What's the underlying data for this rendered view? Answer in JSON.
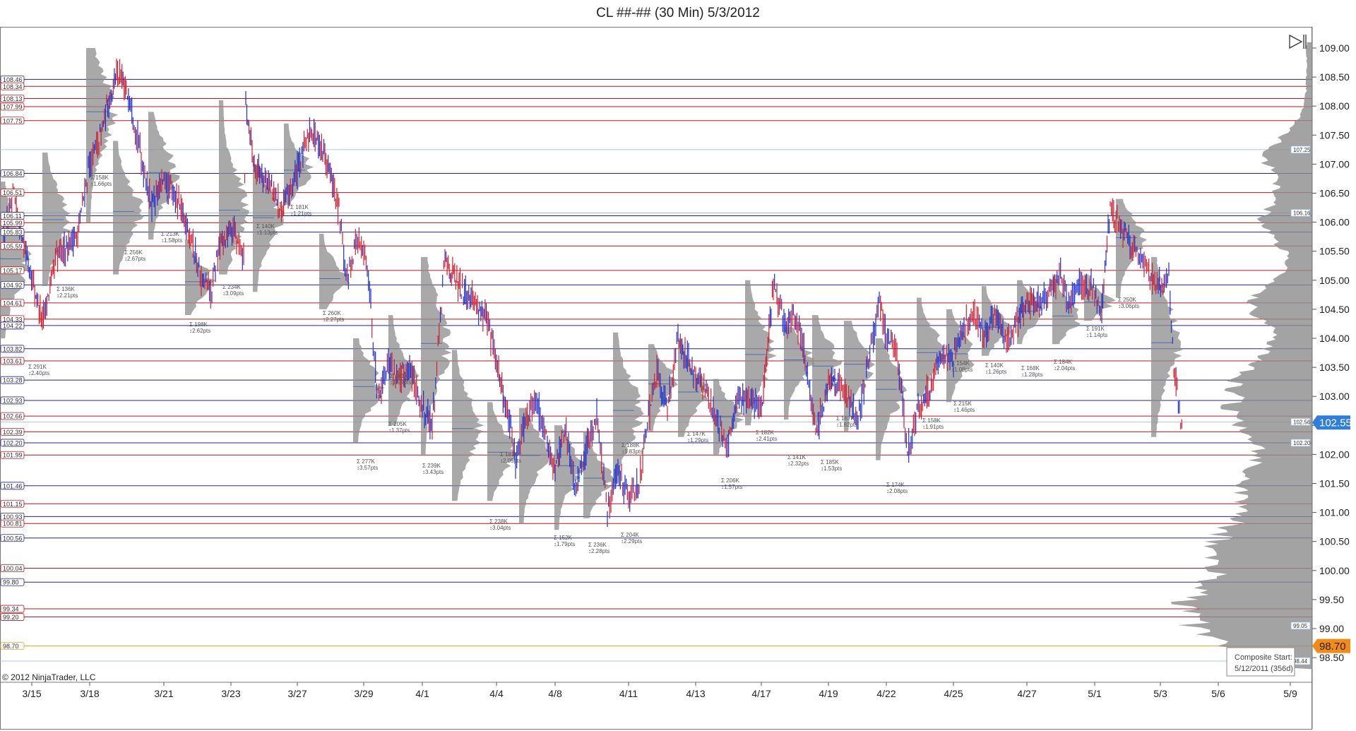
{
  "title": "CL ##-## (30 Min)  5/3/2012",
  "copyright": "© 2012 NinjaTrader, LLC",
  "last_price_label": "102.55",
  "alert_price_label": "98.70",
  "composite_box": {
    "line1": "Composite Start:",
    "line2": "5/12/2011 (356d)"
  },
  "colors": {
    "bull": "#1f2fd0",
    "bear": "#d01f2f",
    "blue_line": "#23238e",
    "red_line": "#b8141e",
    "gold_line": "#e3a21a",
    "profile": "#8c8c8c",
    "last_tag": "#2f7fd8",
    "alert_tag": "#f28c18"
  },
  "chart_data": {
    "type": "line",
    "title": "CL ##-## (30 Min)  5/3/2012",
    "ylim": [
      98.2,
      109.3
    ],
    "y_ticks": [
      "98.50",
      "99.00",
      "99.50",
      "100.00",
      "100.50",
      "101.00",
      "101.50",
      "102.00",
      "102.50",
      "103.00",
      "103.50",
      "104.00",
      "104.50",
      "105.00",
      "105.50",
      "106.00",
      "106.50",
      "107.00",
      "107.50",
      "108.00",
      "108.50",
      "109.00"
    ],
    "x_labels": [
      "3/15",
      "3/18",
      "3/21",
      "3/23",
      "3/27",
      "3/29",
      "4/1",
      "4/4",
      "4/8",
      "4/11",
      "4/13",
      "4/17",
      "4/19",
      "4/22",
      "4/25",
      "4/27",
      "5/1",
      "5/3",
      "5/6",
      "5/9"
    ],
    "series": [
      {
        "x": [
          "3/15",
          "3/18",
          "3/21",
          "3/23",
          "3/27",
          "3/29",
          "4/1",
          "4/4",
          "4/8",
          "4/11",
          "4/13",
          "4/17",
          "4/19",
          "4/22",
          "4/25",
          "4/27",
          "5/1",
          "5/3"
        ],
        "values": [
          105.6,
          108.2,
          106.6,
          105.6,
          107.0,
          105.4,
          103.5,
          104.0,
          102.0,
          101.4,
          103.2,
          102.8,
          103.5,
          102.8,
          103.9,
          104.6,
          106.0,
          102.55
        ]
      }
    ],
    "horizontal_levels": [
      {
        "price": 108.46,
        "label": "108.46",
        "color": "blue"
      },
      {
        "price": 108.34,
        "label": "108.34",
        "color": "red"
      },
      {
        "price": 108.13,
        "label": "108.13",
        "color": "red"
      },
      {
        "price": 107.99,
        "label": "107.99",
        "color": "red"
      },
      {
        "price": 107.75,
        "label": "107.75",
        "color": "red"
      },
      {
        "price": 106.84,
        "label": "106.84",
        "color": "blue"
      },
      {
        "price": 106.51,
        "label": "106.51",
        "color": "red"
      },
      {
        "price": 106.11,
        "label": "106.11",
        "color": "blue"
      },
      {
        "price": 105.99,
        "label": "105.99",
        "color": "red"
      },
      {
        "price": 105.83,
        "label": "105.83",
        "color": "blue"
      },
      {
        "price": 105.59,
        "label": "105.59",
        "color": "red"
      },
      {
        "price": 105.17,
        "label": "105.17",
        "color": "red"
      },
      {
        "price": 104.92,
        "label": "104.92",
        "color": "blue"
      },
      {
        "price": 104.61,
        "label": "104.61",
        "color": "red"
      },
      {
        "price": 104.33,
        "label": "104.33",
        "color": "red"
      },
      {
        "price": 104.22,
        "label": "104.22",
        "color": "blue"
      },
      {
        "price": 103.82,
        "label": "103.82",
        "color": "blue"
      },
      {
        "price": 103.61,
        "label": "103.61",
        "color": "red"
      },
      {
        "price": 103.28,
        "label": "103.28",
        "color": "blue"
      },
      {
        "price": 102.93,
        "label": "102.93",
        "color": "blue"
      },
      {
        "price": 102.66,
        "label": "102.66",
        "color": "red"
      },
      {
        "price": 102.39,
        "label": "102.39",
        "color": "red"
      },
      {
        "price": 102.2,
        "label": "102.20",
        "color": "blue"
      },
      {
        "price": 101.99,
        "label": "101.99",
        "color": "red"
      },
      {
        "price": 101.46,
        "label": "101.46",
        "color": "blue"
      },
      {
        "price": 101.15,
        "label": "101.15",
        "color": "red"
      },
      {
        "price": 100.93,
        "label": "100.93",
        "color": "blue"
      },
      {
        "price": 100.81,
        "label": "100.81",
        "color": "red"
      },
      {
        "price": 100.56,
        "label": "100.56",
        "color": "blue"
      },
      {
        "price": 100.04,
        "label": "100.04",
        "color": "red"
      },
      {
        "price": 99.8,
        "label": "99.80",
        "color": "blue"
      },
      {
        "price": 99.34,
        "label": "99.34",
        "color": "red"
      },
      {
        "price": 99.2,
        "label": "99.20",
        "color": "red"
      },
      {
        "price": 98.7,
        "label": "98.70",
        "color": "gold"
      }
    ],
    "right_axis_tags": [
      "107.25",
      "106.16",
      "102.56",
      "102.20",
      "99.05",
      "98.44"
    ],
    "session_annotations": [
      {
        "label": "3/15",
        "vol": "Σ 291K",
        "range": "↕2.40pts"
      },
      {
        "label": "3/15",
        "vol": "Σ 136K",
        "range": "↕2.21pts"
      },
      {
        "label": "3/18",
        "vol": "Σ 158K",
        "range": "↕1.66pts"
      },
      {
        "label": "3/18",
        "vol": "Σ 256K",
        "range": "↕2.67pts"
      },
      {
        "label": "3/21",
        "vol": "Σ 213K",
        "range": "↕1.58pts"
      },
      {
        "label": "3/21",
        "vol": "Σ 198K",
        "range": "↕2.62pts"
      },
      {
        "label": "3/23",
        "vol": "Σ 234K",
        "range": "↕3.09pts"
      },
      {
        "label": "3/23",
        "vol": "Σ 140K",
        "range": "↕1.13pts"
      },
      {
        "label": "3/27",
        "vol": "Σ 181K",
        "range": "↕1.21pts"
      },
      {
        "label": "3/27",
        "vol": "Σ 260K",
        "range": "↕2.27pts"
      },
      {
        "label": "3/29",
        "vol": "Σ 277K",
        "range": "↕3.57pts"
      },
      {
        "label": "3/29",
        "vol": "Σ 205K",
        "range": "↕1.37pts"
      },
      {
        "label": "4/1",
        "vol": "Σ 239K",
        "range": "↕3.43pts"
      },
      {
        "label": "4/1",
        "vol": "Σ 181K",
        "range": "↕1.59pts"
      },
      {
        "label": "4/4",
        "vol": "Σ 238K",
        "range": "↕3.04pts"
      },
      {
        "label": "4/4",
        "vol": "Σ 188K",
        "range": "↕2.05pts"
      },
      {
        "label": "4/8",
        "vol": "Σ 152K",
        "range": "↕1.79pts"
      },
      {
        "label": "4/8",
        "vol": "Σ 236K",
        "range": "↕2.28pts"
      },
      {
        "label": "4/11",
        "vol": "Σ 204K",
        "range": "↕2.29pts"
      },
      {
        "label": "4/11",
        "vol": "Σ 188K",
        "range": "↕1.83pts"
      },
      {
        "label": "4/13",
        "vol": "Σ 147K",
        "range": "↕1.29pts"
      },
      {
        "label": "4/13",
        "vol": "Σ 206K",
        "range": "↕1.57pts"
      },
      {
        "label": "4/17",
        "vol": "Σ 182K",
        "range": "↕2.41pts"
      },
      {
        "label": "4/17",
        "vol": "Σ 141K",
        "range": "↕2.32pts"
      },
      {
        "label": "4/19",
        "vol": "Σ 185K",
        "range": "↕1.53pts"
      },
      {
        "label": "4/19",
        "vol": "Σ 167K",
        "range": "↕1.82pts"
      },
      {
        "label": "4/22",
        "vol": "Σ 174K",
        "range": "↕2.08pts"
      },
      {
        "label": "4/22",
        "vol": "Σ 158K",
        "range": "↕1.91pts"
      },
      {
        "label": "4/25",
        "vol": "Σ 215K",
        "range": "↕1.46pts"
      },
      {
        "label": "4/25",
        "vol": "Σ 154K",
        "range": "↕1.08pts"
      },
      {
        "label": "4/27",
        "vol": "Σ 140K",
        "range": "↕1.26pts"
      },
      {
        "label": "4/27",
        "vol": "Σ 168K",
        "range": "↕1.28pts"
      },
      {
        "label": "5/1",
        "vol": "Σ 184K",
        "range": "↕2.04pts"
      },
      {
        "label": "5/1",
        "vol": "Σ 191K",
        "range": "↕1.14pts"
      },
      {
        "label": "5/3",
        "vol": "Σ 250K",
        "range": "↕3.06pts"
      }
    ],
    "grid": false,
    "legend": "none"
  }
}
